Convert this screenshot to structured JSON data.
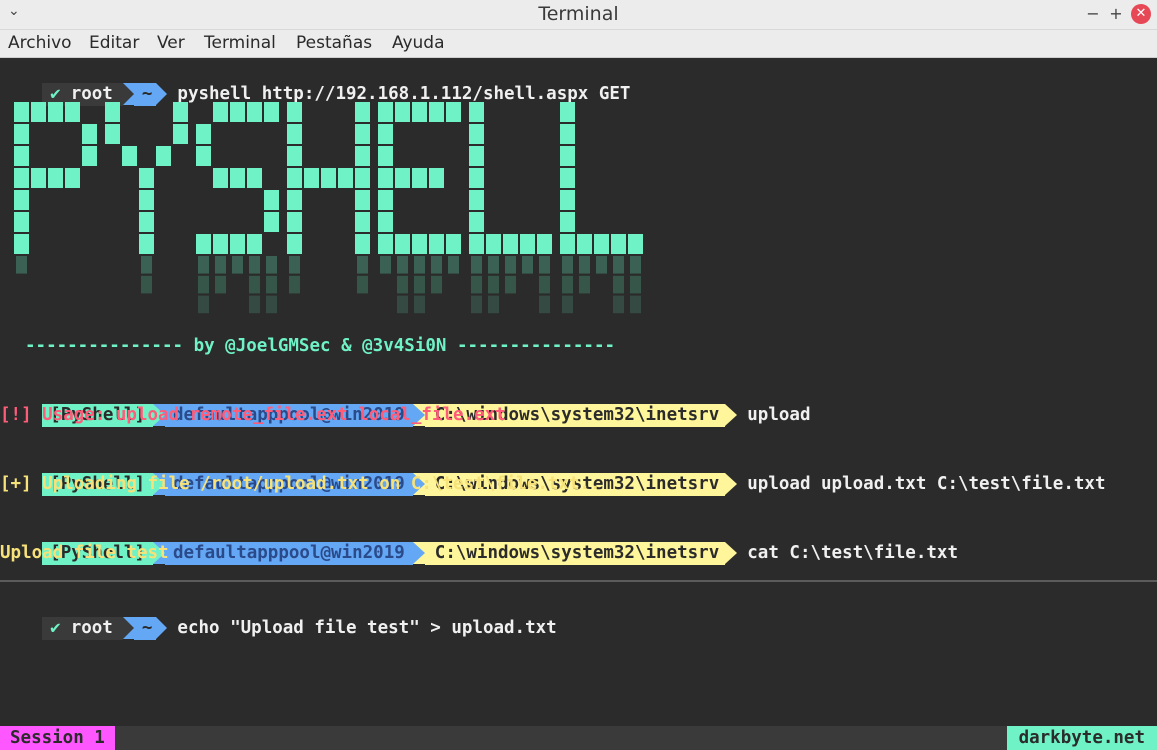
{
  "window": {
    "title": "Terminal",
    "menu": [
      "Archivo",
      "Editar",
      "Ver",
      "Terminal",
      "Pestañas",
      "Ayuda"
    ]
  },
  "colors": {
    "bg": "#2b2b2b",
    "teal": "#6ff2c6",
    "blue": "#64a8f5",
    "yellow": "#fff59a",
    "red": "#ff5c7a",
    "gold": "#f7e27a",
    "magenta": "#ff57ff"
  },
  "terminal": {
    "prompt1": {
      "check": "✔",
      "user": "root",
      "dir": "~",
      "command": "pyshell http://192.168.1.112/shell.aspx GET"
    },
    "banner": {
      "text": "PYSHELL"
    },
    "tagline": "--------------- by @JoelGMSec & @3v4Si0N ---------------",
    "ps_prompts": [
      {
        "tag": "[PyShell]",
        "host": "defaultapppool@win2019",
        "path": "C:\\windows\\system32\\inetsrv",
        "command": "upload",
        "output": "[!] Usage: upload remote_file.ext local_file.ext"
      },
      {
        "tag": "[PyShell]",
        "host": "defaultapppool@win2019",
        "path": "C:\\windows\\system32\\inetsrv",
        "command": "upload upload.txt C:\\test\\file.txt",
        "output": "[+] Uploading file /root/upload.txt on C:\\test\\file.txt.."
      },
      {
        "tag": "[PyShell]",
        "host": "defaultapppool@win2019",
        "path": "C:\\windows\\system32\\inetsrv",
        "command": "cat C:\\test\\file.txt",
        "output": "Upload file test"
      }
    ],
    "prompt2": {
      "check": "✔",
      "user": "root",
      "dir": "~",
      "command": "echo \"Upload file test\" > upload.txt"
    }
  },
  "statusbar": {
    "session": "Session 1",
    "site": "darkbyte.net"
  }
}
